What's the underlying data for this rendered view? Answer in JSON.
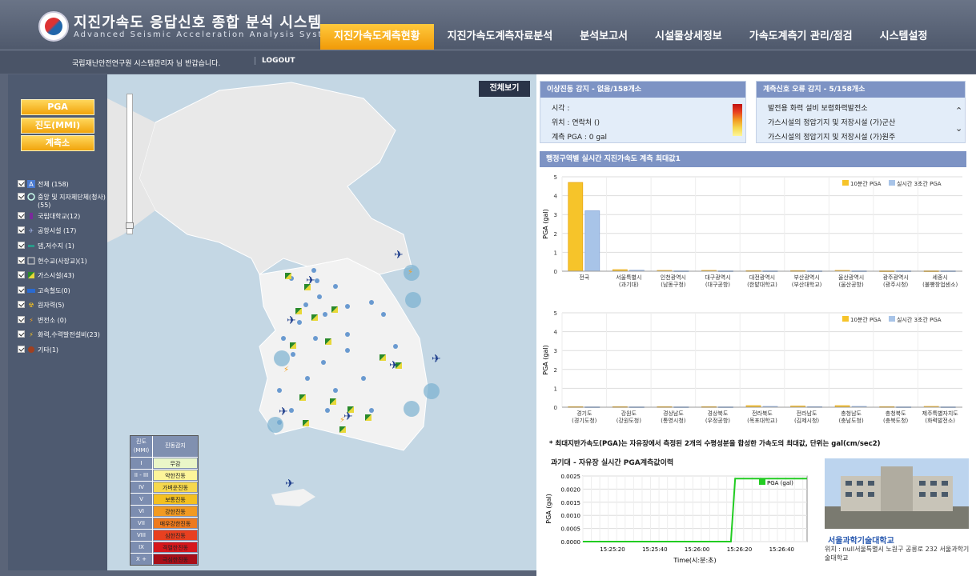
{
  "header": {
    "title": "지진가속도 응답신호 종합 분석 시스템",
    "subtitle": "Advanced Seismic Acceleration Analysis System"
  },
  "nav": [
    "지진가속도계측현황",
    "지진가속도계측자료분석",
    "분석보고서",
    "시설물상세정보",
    "가속도계측기 관리/점검",
    "시스템설정"
  ],
  "subbar": {
    "welcome": "국립재난안전연구원  시스템관리자 님 반갑습니다.",
    "logout": "LOGOUT"
  },
  "sidebar": {
    "modes": [
      "PGA",
      "진도(MMI)",
      "계측소"
    ],
    "layers": [
      {
        "label": "전체 (158)",
        "icon": "all-icon"
      },
      {
        "label": "중앙 및 지자체단체(청사) (55)",
        "icon": "government-circle-icon"
      },
      {
        "label": "국립대학교(12)",
        "icon": "university-icon"
      },
      {
        "label": "공항시설 (17)",
        "icon": "airplane-icon"
      },
      {
        "label": "댐,저수지 (1)",
        "icon": "dam-icon"
      },
      {
        "label": "현수교(사장교)(1)",
        "icon": "bridge-icon"
      },
      {
        "label": "가스시설(43)",
        "icon": "gas-flag-icon"
      },
      {
        "label": "고속철도(0)",
        "icon": "train-icon"
      },
      {
        "label": "원자력(5)",
        "icon": "nuclear-icon"
      },
      {
        "label": "변전소 (0)",
        "icon": "substation-icon"
      },
      {
        "label": "화력,수력발전설비(23)",
        "icon": "power-plant-icon"
      },
      {
        "label": "기타(1)",
        "icon": "other-icon"
      }
    ]
  },
  "map": {
    "full_view": "전체보기"
  },
  "mmi_legend": {
    "header": [
      "진도\n(MMI)",
      "진동감지"
    ],
    "rows": [
      {
        "level": "I",
        "label": "무감",
        "color": "#eaf6c8"
      },
      {
        "level": "II - III",
        "label": "약한진동",
        "color": "#fdf59a"
      },
      {
        "level": "IV",
        "label": "가벼운진동",
        "color": "#f6d84e"
      },
      {
        "level": "V",
        "label": "보통진동",
        "color": "#f3c021"
      },
      {
        "level": "VI",
        "label": "강한진동",
        "color": "#f19a22"
      },
      {
        "level": "VII",
        "label": "매우강한진동",
        "color": "#ee7a1e"
      },
      {
        "level": "VIII",
        "label": "심한진동",
        "color": "#e84020"
      },
      {
        "level": "IX",
        "label": "격렬한진동",
        "color": "#d6171c"
      },
      {
        "level": "X +",
        "label": "극심한진동",
        "color": "#a80e18"
      }
    ]
  },
  "alert_panel": {
    "title": "이상진동 감지 - 없음/158개소",
    "lines": [
      "시각 :",
      "위치 :       연락처 ()",
      "계측 PGA : 0 gal"
    ]
  },
  "error_panel": {
    "title": "계측신호 오류 감지 - 5/158개소",
    "lines": [
      "발전용 화력 설비 보령화력발전소",
      "가스시설의 정압기지 및 저장시설 (가)군산",
      "가스시설의 정압기지 및 저장시설 (가)원주"
    ]
  },
  "chart_section": {
    "title": "행정구역별 실시간 지진가속도 계측 최대값1"
  },
  "chart_data": [
    {
      "type": "bar",
      "ylabel": "PGA (gal)",
      "ylim": [
        0,
        5
      ],
      "ticks": [
        0,
        1,
        2,
        3,
        4,
        5
      ],
      "categories": [
        "전국",
        "서울특별시\n(과기대)",
        "인천광역시\n(남동구청)",
        "대구광역시\n(대구공항)",
        "대전광역시\n(한밭대학교)",
        "부산광역시\n(부산대학교)",
        "울산광역시\n(울산공항)",
        "광주광역시\n(광주시청)",
        "세종시\n(불빵창업센소)"
      ],
      "series": [
        {
          "name": "10분간 PGA",
          "color": "#f6c42a",
          "values": [
            4.7,
            0.08,
            0.04,
            0.04,
            0.03,
            0.03,
            0.04,
            0.02,
            0.02
          ]
        },
        {
          "name": "실시간 3초간 PGA",
          "color": "#a8c4e8",
          "values": [
            3.2,
            0.05,
            0.02,
            0.02,
            0.02,
            0.02,
            0.02,
            0.02,
            0.02
          ]
        }
      ]
    },
    {
      "type": "bar",
      "ylabel": "PGA (gal)",
      "ylim": [
        0,
        5
      ],
      "ticks": [
        0,
        1,
        2,
        3,
        4,
        5
      ],
      "categories": [
        "경기도\n(경기도청)",
        "강원도\n(강원도청)",
        "경상남도\n(통영시청)",
        "경상북도\n(우정공항)",
        "전라북도\n(목포대학교)",
        "전라남도\n(김제시청)",
        "충청남도\n(충남도청)",
        "충청북도\n(충북도청)",
        "제주특별자치도\n(화력발전소)"
      ],
      "series": [
        {
          "name": "10분간 PGA",
          "color": "#f6c42a",
          "values": [
            0.03,
            0.03,
            0.03,
            0.03,
            0.08,
            0.06,
            0.08,
            0.03,
            0.04
          ]
        },
        {
          "name": "실시간 3초간 PGA",
          "color": "#a8c4e8",
          "values": [
            0.02,
            0.02,
            0.02,
            0.02,
            0.04,
            0.03,
            0.04,
            0.02,
            0.02
          ]
        }
      ]
    },
    {
      "type": "line",
      "title": "과기대 - 자유장 실시간 PGA계측값이력",
      "xlabel": "Time(시:분:초)",
      "ylabel": "PGA (gal)",
      "ylim": [
        0,
        0.0025
      ],
      "yticks": [
        "0.0000",
        "0.0005",
        "0.0010",
        "0.0015",
        "0.0020",
        "0.0025"
      ],
      "xticks": [
        "15:25:20",
        "15:25:40",
        "15:26:00",
        "15:26:20",
        "15:26:40"
      ],
      "series": [
        {
          "name": "PGA (gal)",
          "color": "#22cc22",
          "points": [
            [
              "15:25:06",
              0
            ],
            [
              "15:26:16",
              0
            ],
            [
              "15:26:18",
              0.0024
            ],
            [
              "15:26:52",
              0.0024
            ]
          ]
        }
      ]
    }
  ],
  "note": "* 최대지반가속도(PGA)는 자유장에서 측정된 2개의 수평성분을 합성한 가속도의 최대값, 단위는 gal(cm/sec2)",
  "station": {
    "name": "서울과학기술대학교",
    "address": "위치 : null서울특별시 노원구 공릉로 232 서울과학기술대학교"
  }
}
